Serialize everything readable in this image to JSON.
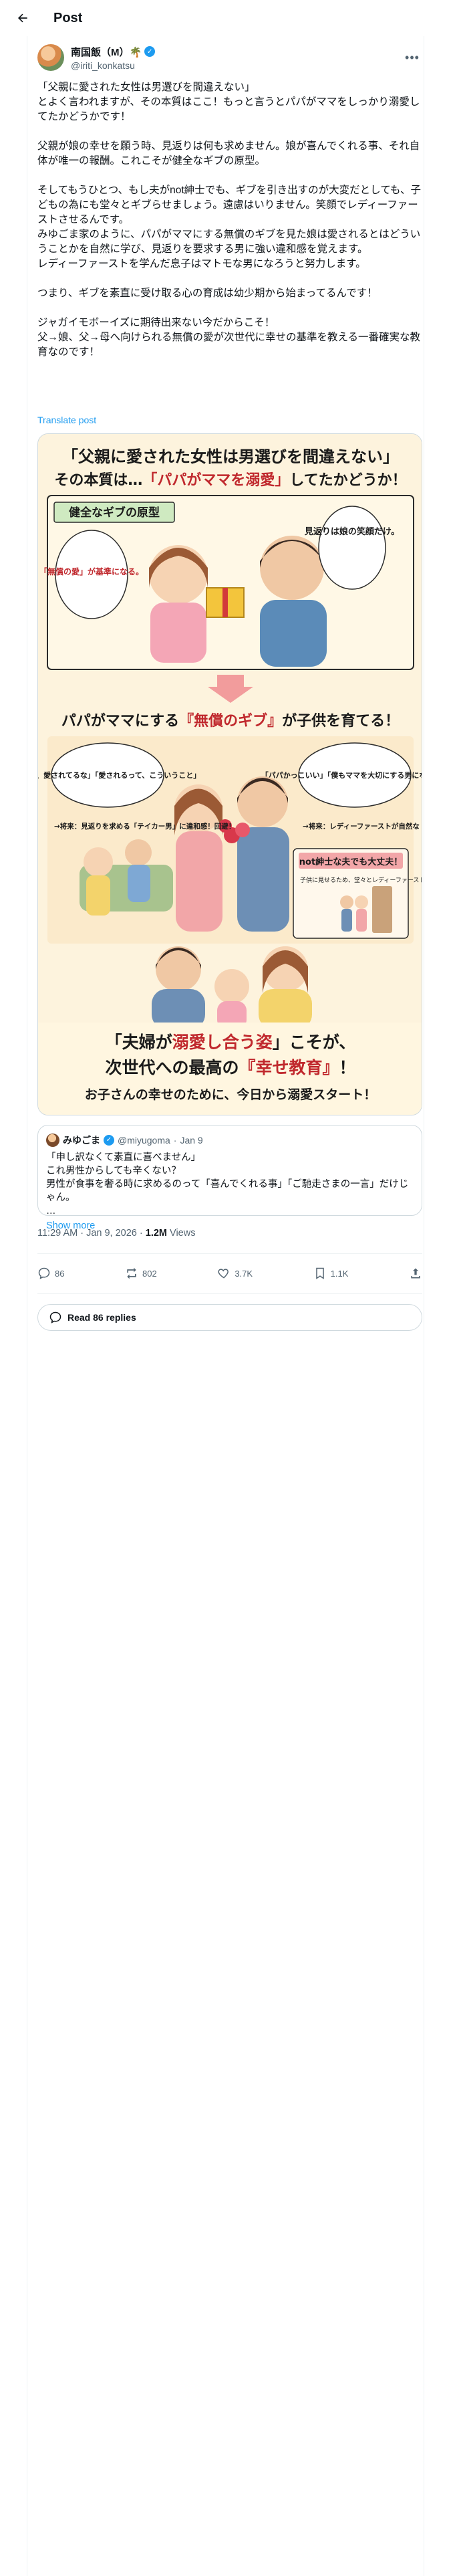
{
  "header": {
    "title": "Post"
  },
  "author": {
    "display_name": "南国飯（M）🌴",
    "handle": "@iriti_konkatsu"
  },
  "post": {
    "paragraphs": [
      [
        "「父親に愛された女性は男選びを間違えない」",
        "とよく言われますが、その本質はここ！もっと言うとパパがママをしっかり溺愛してたかどうかです！"
      ],
      [
        "父親が娘の幸せを願う時、見返りは何も求めません。娘が喜んでくれる事、それ自体が唯一の報酬。これこそが健全なギブの原型。"
      ],
      [
        "そしてもうひとつ、もし夫がnot紳士でも、ギブを引き出すのが大変だとしても、子どもの為にも堂々とギブらせましょう。遠慮はいりません。笑顔でレディーファーストさせるんです。",
        "みゆごま家のように、パパがママにする無償のギブを見た娘は愛されるとはどういうことかを自然に学び、見返りを要求する男に強い違和感を覚えます。",
        "レディーファーストを学んだ息子はマトモな男になろうと努力します。"
      ],
      [
        "つまり、ギブを素直に受け取る心の育成は幼少期から始まってるんです！"
      ],
      [
        "ジャガイモボーイズに期待出来ない今だからこそ！",
        "父→娘、父→母へ向けられる無償の愛が次世代に幸せの基準を教える一番確実な教育なのです！"
      ]
    ],
    "translate_label": "Translate post"
  },
  "image": {
    "headline_1": "「父親に愛された女性は男選びを間違えない」",
    "headline_2a": "その本質は…",
    "headline_2b": "「パパがママを溺愛」",
    "headline_2c": "してたかどうか！",
    "badge_gift": "健全なギブの原型",
    "bubble_dad": "見返りは娘の笑顔だけ。",
    "bubble_daughter": "「無償の愛」が基準になる。",
    "section_2a": "パパがママにする",
    "section_2b": "『無償のギブ』",
    "section_2c": "が子供を育てる！",
    "bubble_girl": "「ママ、愛されてるな」「愛されるって、こういうこと」",
    "bubble_boy": "「パパかっこいい」「僕もママを大切にする男になろう」",
    "note_girl": "→将来：見返りを求める「テイカー男」に違和感！回避！",
    "note_boy": "→将来：レディーファーストが自然な「マトモな男」に！",
    "badge_notshinshi": "not紳士な夫でも大丈夫！",
    "note_notshinshi": "子供に見せるため、堂々とレディーファーストさせよう！遠慮は不要。",
    "footer_1a": "「夫婦が",
    "footer_1b": "溺愛し合う姿",
    "footer_1c": "」こそが、",
    "footer_2a": "次世代への最高の",
    "footer_2b": "『幸せ教育』",
    "footer_2c": "！",
    "footer_3": "お子さんの幸せのために、今日から溺愛スタート！"
  },
  "quote": {
    "name": "みゆごま",
    "handle": "@miyugoma",
    "date": "Jan 9",
    "lines": [
      "「申し訳なくて素直に喜べません」",
      "これ男性からしても辛くない？",
      "男性が食事を奢る時に求めるのって「喜んでくれる事」「ご馳走さまの一言」だけじゃん。"
    ],
    "ellipsis": "…",
    "show_more": "Show more"
  },
  "meta": {
    "time": "11:29 AM · Jan 9, 2026 · ",
    "views_count": "1.2M",
    "views_label": " Views"
  },
  "actions": {
    "replies": "86",
    "reposts": "802",
    "likes": "3.7K",
    "bookmarks": "1.1K"
  },
  "read_replies_label": "Read 86 replies",
  "colors": {
    "accent": "#1d9bf0",
    "text": "#0f1419",
    "muted": "#536471",
    "border": "#cfd9de",
    "highlight_red": "#c0282d"
  }
}
